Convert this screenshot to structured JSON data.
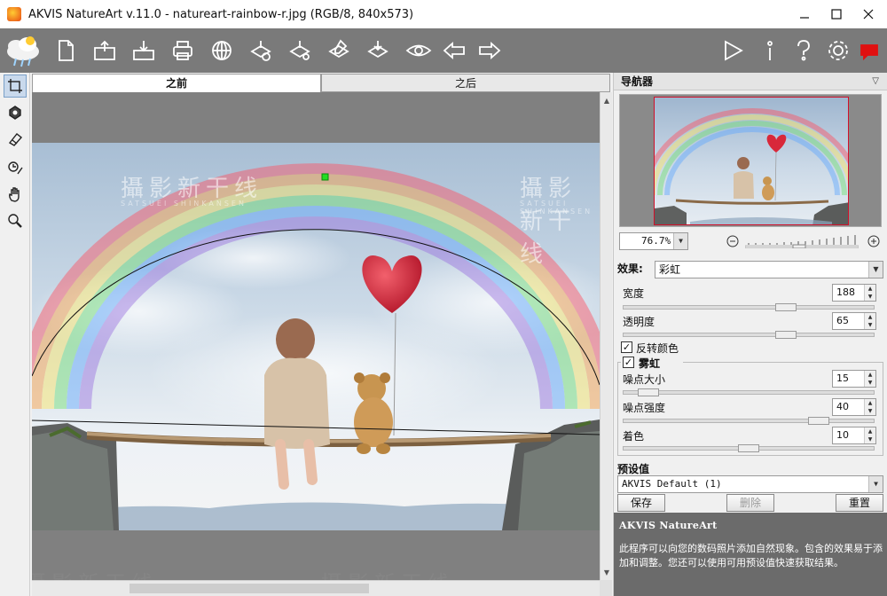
{
  "window": {
    "title": "AKVIS NatureArt v.11.0 - natureart-rainbow-r.jpg (RGB/8, 840x573)"
  },
  "toolbar": {
    "icons": [
      "new-file-icon",
      "open-icon",
      "save-icon",
      "print-icon",
      "share-icon",
      "batch-icon",
      "preferences-icon",
      "edit-icon",
      "export-icon",
      "preview-icon",
      "back-icon",
      "forward-icon",
      "run-icon",
      "info-icon",
      "help-icon",
      "settings-icon",
      "notifications-icon"
    ]
  },
  "left_tools": [
    "crop-tool-icon",
    "brush-tool-icon",
    "eraser-tool-icon",
    "history-brush-icon",
    "hand-tool-icon",
    "zoom-tool-icon"
  ],
  "tabs": [
    {
      "label": "之前",
      "active": true
    },
    {
      "label": "之后",
      "active": false
    }
  ],
  "watermark": {
    "text": "攝影新干线",
    "sub": "SATSUEI SHINKANSEN"
  },
  "navigator": {
    "title": "导航器",
    "zoom": "76.7%"
  },
  "effect": {
    "label": "效果:",
    "value": "彩虹"
  },
  "params": {
    "width": {
      "label": "宽度",
      "value": "188",
      "level": 0.65
    },
    "opacity": {
      "label": "透明度",
      "value": "65",
      "level": 0.65
    },
    "invert": {
      "label": "反转颜色",
      "checked": true
    },
    "fog": {
      "label": "雾虹",
      "checked": true
    },
    "noise_size": {
      "label": "噪点大小",
      "value": "15",
      "level": 0.1
    },
    "noise_strength": {
      "label": "噪点强度",
      "value": "40",
      "level": 0.78
    },
    "tint": {
      "label": "着色",
      "value": "10",
      "level": 0.5
    }
  },
  "presets": {
    "title": "预设值",
    "value": "AKVIS Default (1)",
    "save_label": "保存",
    "delete_label": "删除",
    "reset_label": "重置"
  },
  "info": {
    "heading": "AKVIS NatureArt",
    "text": "此程序可以向您的数码照片添加自然现象。包含的效果易于添加和调整。您还可以使用可用预设值快速获取结果。"
  },
  "colors": {
    "toolbar_bg": "#7a7a7a",
    "accent_red": "#d0102a",
    "balloon": "#d8283a",
    "handle": "#22dd22"
  }
}
